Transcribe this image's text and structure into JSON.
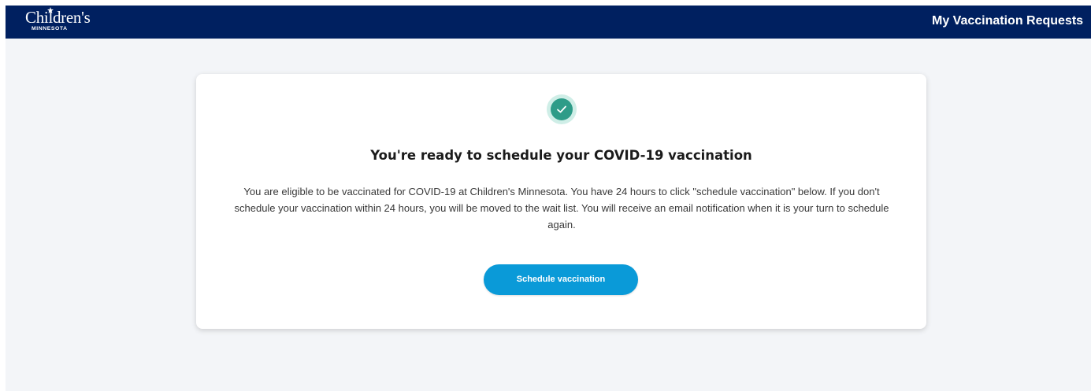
{
  "header": {
    "logo_text": "Children's",
    "logo_subtext": "MINNESOTA",
    "nav_link": "My Vaccination Requests"
  },
  "card": {
    "icon": "check-circle-icon",
    "title": "You're ready to schedule your COVID-19 vaccination",
    "body": "You are eligible to be vaccinated for COVID-19 at Children's Minnesota. You have 24 hours to click \"schedule vaccination\" below. If you don't schedule your vaccination within 24 hours, you will be moved to the wait list. You will receive an email notification when it is your turn to schedule again.",
    "button_label": "Schedule vaccination"
  },
  "colors": {
    "header_bg": "#002060",
    "page_bg": "#f3f5f8",
    "accent_button": "#0a9ad8",
    "success_icon": "#2e9c88",
    "success_halo": "#cfeee7"
  }
}
